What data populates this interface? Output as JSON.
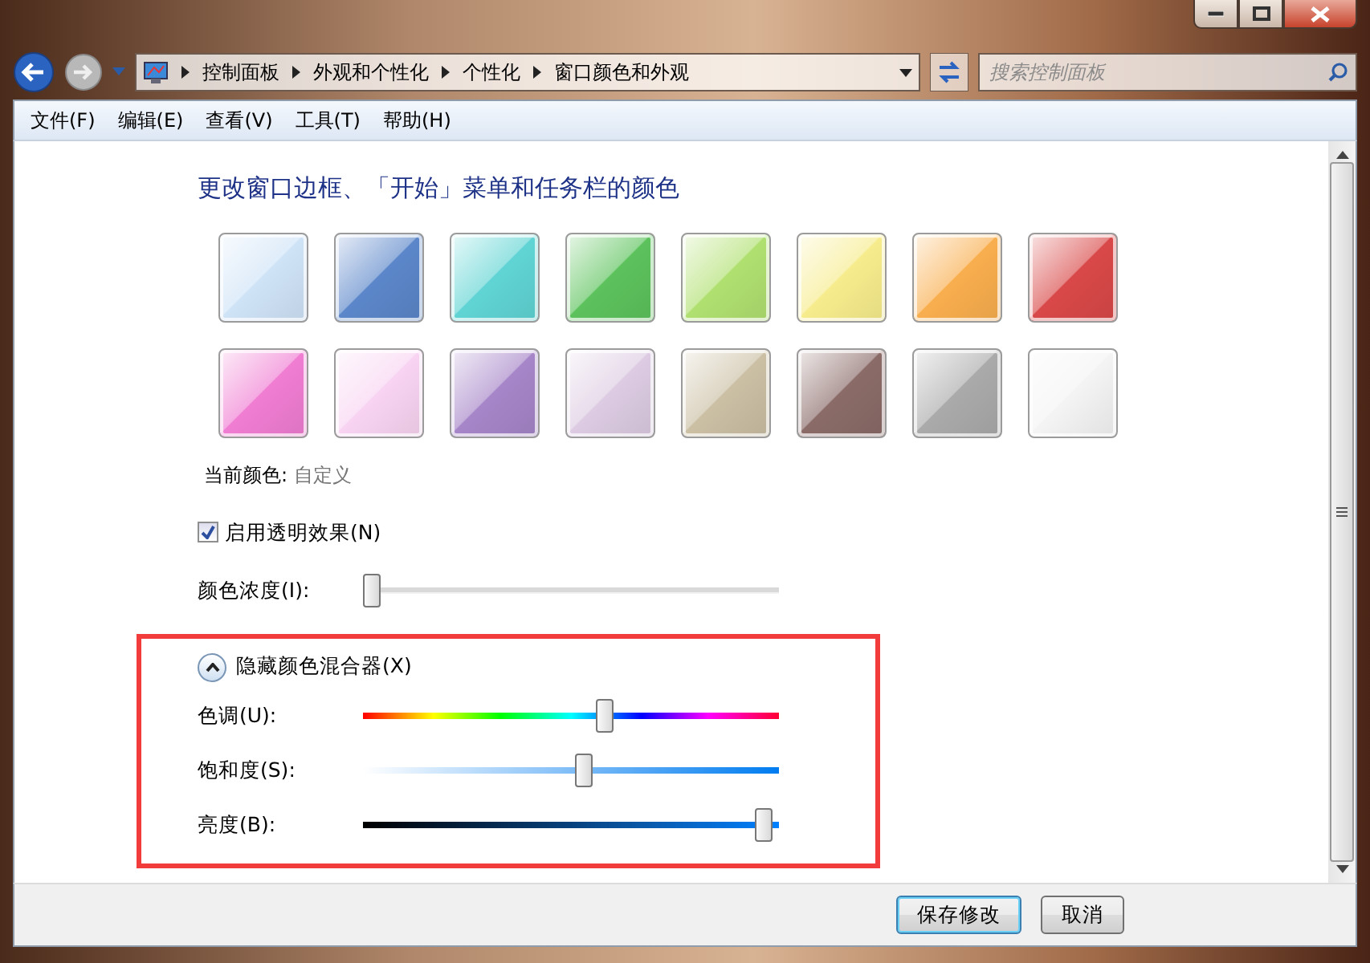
{
  "address_bar": {
    "crumbs": [
      "控制面板",
      "外观和个性化",
      "个性化",
      "窗口颜色和外观"
    ]
  },
  "search": {
    "placeholder": "搜索控制面板"
  },
  "menu": [
    "文件(F)",
    "编辑(E)",
    "查看(V)",
    "工具(T)",
    "帮助(H)"
  ],
  "heading": "更改窗口边框、「开始」菜单和任务栏的颜色",
  "swatches": [
    {
      "color": "#cfe3f7"
    },
    {
      "color": "#5b86c9"
    },
    {
      "color": "#60d4d4"
    },
    {
      "color": "#5cc25c"
    },
    {
      "color": "#b0e070"
    },
    {
      "color": "#f7ec8c"
    },
    {
      "color": "#f9ae4e"
    },
    {
      "color": "#d94848"
    },
    {
      "color": "#f07dd2"
    },
    {
      "color": "#f8d4f2"
    },
    {
      "color": "#a685c8"
    },
    {
      "color": "#dccbe2"
    },
    {
      "color": "#cbbfa4"
    },
    {
      "color": "#8a6b68"
    },
    {
      "color": "#aaaaaa"
    },
    {
      "color": "#f4f4f4"
    }
  ],
  "current_color": {
    "label": "当前颜色:",
    "value": "自定义"
  },
  "transparency": {
    "label": "启用透明效果(N)",
    "checked": true
  },
  "intensity": {
    "label": "颜色浓度(I):",
    "level": 0.02
  },
  "mixer": {
    "toggle": "隐藏颜色混合器(X)",
    "expanded": true,
    "sliders": [
      {
        "label": "色调(U):",
        "kind": "hue",
        "level": 0.58
      },
      {
        "label": "饱和度(S):",
        "kind": "saturation",
        "level": 0.53
      },
      {
        "label": "亮度(B):",
        "kind": "brightness",
        "level": 0.96
      }
    ]
  },
  "buttons": [
    {
      "label": "保存修改",
      "default": true
    },
    {
      "label": "取消",
      "default": false
    }
  ]
}
